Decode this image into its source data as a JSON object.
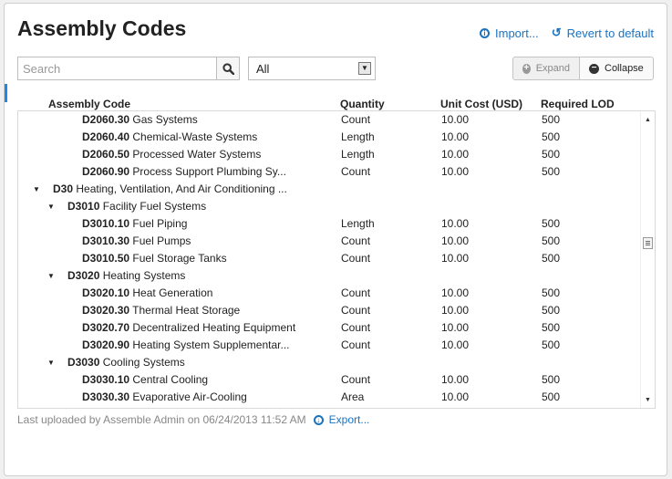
{
  "header": {
    "title": "Assembly Codes",
    "import_label": "Import...",
    "revert_label": "Revert to default"
  },
  "toolbar": {
    "search_placeholder": "Search",
    "filter_value": "All",
    "expand_label": "Expand",
    "collapse_label": "Collapse"
  },
  "table": {
    "columns": [
      "Assembly Code",
      "Quantity",
      "Unit Cost (USD)",
      "Required LOD"
    ],
    "rows": [
      {
        "level": 3,
        "toggle": "",
        "code": "D2060.30",
        "name": "Gas Systems",
        "quantity": "Count",
        "unit_cost": "10.00",
        "lod": "500"
      },
      {
        "level": 3,
        "toggle": "",
        "code": "D2060.40",
        "name": "Chemical-Waste Systems",
        "quantity": "Length",
        "unit_cost": "10.00",
        "lod": "500"
      },
      {
        "level": 3,
        "toggle": "",
        "code": "D2060.50",
        "name": "Processed Water Systems",
        "quantity": "Length",
        "unit_cost": "10.00",
        "lod": "500"
      },
      {
        "level": 3,
        "toggle": "",
        "code": "D2060.90",
        "name": "Process Support Plumbing Sy...",
        "quantity": "Count",
        "unit_cost": "10.00",
        "lod": "500"
      },
      {
        "level": 1,
        "toggle": "▼",
        "code": "D30",
        "name": "Heating, Ventilation, And Air Conditioning ...",
        "quantity": "",
        "unit_cost": "",
        "lod": ""
      },
      {
        "level": 2,
        "toggle": "▼",
        "code": "D3010",
        "name": "Facility Fuel Systems",
        "quantity": "",
        "unit_cost": "",
        "lod": ""
      },
      {
        "level": 3,
        "toggle": "",
        "code": "D3010.10",
        "name": "Fuel Piping",
        "quantity": "Length",
        "unit_cost": "10.00",
        "lod": "500"
      },
      {
        "level": 3,
        "toggle": "",
        "code": "D3010.30",
        "name": "Fuel Pumps",
        "quantity": "Count",
        "unit_cost": "10.00",
        "lod": "500"
      },
      {
        "level": 3,
        "toggle": "",
        "code": "D3010.50",
        "name": "Fuel Storage Tanks",
        "quantity": "Count",
        "unit_cost": "10.00",
        "lod": "500"
      },
      {
        "level": 2,
        "toggle": "▼",
        "code": "D3020",
        "name": "Heating Systems",
        "quantity": "",
        "unit_cost": "",
        "lod": ""
      },
      {
        "level": 3,
        "toggle": "",
        "code": "D3020.10",
        "name": "Heat Generation",
        "quantity": "Count",
        "unit_cost": "10.00",
        "lod": "500"
      },
      {
        "level": 3,
        "toggle": "",
        "code": "D3020.30",
        "name": "Thermal Heat Storage",
        "quantity": "Count",
        "unit_cost": "10.00",
        "lod": "500"
      },
      {
        "level": 3,
        "toggle": "",
        "code": "D3020.70",
        "name": "Decentralized Heating Equipment",
        "quantity": "Count",
        "unit_cost": "10.00",
        "lod": "500"
      },
      {
        "level": 3,
        "toggle": "",
        "code": "D3020.90",
        "name": "Heating System Supplementar...",
        "quantity": "Count",
        "unit_cost": "10.00",
        "lod": "500"
      },
      {
        "level": 2,
        "toggle": "▼",
        "code": "D3030",
        "name": "Cooling Systems",
        "quantity": "",
        "unit_cost": "",
        "lod": ""
      },
      {
        "level": 3,
        "toggle": "",
        "code": "D3030.10",
        "name": "Central Cooling",
        "quantity": "Count",
        "unit_cost": "10.00",
        "lod": "500"
      },
      {
        "level": 3,
        "toggle": "",
        "code": "D3030.30",
        "name": "Evaporative Air-Cooling",
        "quantity": "Area",
        "unit_cost": "10.00",
        "lod": "500"
      }
    ]
  },
  "footer": {
    "status_text": "Last uploaded by Assemble Admin on 06/24/2013 11:52 AM",
    "export_label": "Export..."
  },
  "colors": {
    "link": "#1a73c1",
    "accent_marker": "#1e88e5"
  },
  "icons": {
    "import": "info-circle-icon",
    "revert": "revert-arrow-icon",
    "search": "search-icon",
    "expand": "plus-circle-icon",
    "collapse": "minus-circle-icon",
    "export": "export-circle-icon",
    "toggle": "triangle-down-icon"
  }
}
